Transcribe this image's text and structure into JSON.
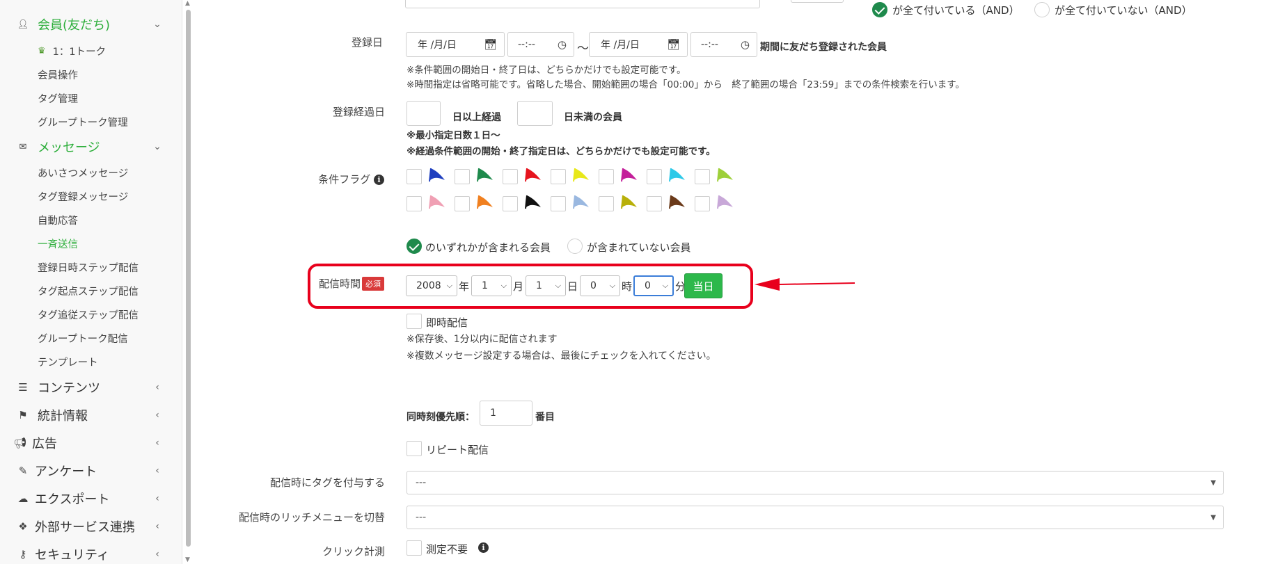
{
  "sidebar": {
    "member_section": "会員(友だち)",
    "member_items": [
      "1：1トーク",
      "会員操作",
      "タグ管理",
      "グループトーク管理"
    ],
    "message_section": "メッセージ",
    "message_items": [
      "あいさつメッセージ",
      "タグ登録メッセージ",
      "自動応答",
      "一斉送信",
      "登録日時ステップ配信",
      "タグ起点ステップ配信",
      "タグ追従ステップ配信",
      "グループトーク配信",
      "テンプレート"
    ],
    "sections": [
      "コンテンツ",
      "統計情報",
      "広告",
      "アンケート",
      "エクスポート",
      "外部サービス連携",
      "セキュリティ"
    ],
    "active_color": "#2cae3a"
  },
  "top": {
    "tag_and_all": "が全て付いている（AND）",
    "tag_and_none": "が全て付いていない（AND）"
  },
  "registration_date": {
    "label": "登録日",
    "date_placeholder": "年 /月/日",
    "time_placeholder": "--:--",
    "tilde": "～",
    "suffix": "期間に友だち登録された会員",
    "note1": "※条件範囲の開始日・終了日は、どちらかだけでも設定可能です。",
    "note2": "※時間指定は省略可能です。省略した場合、開始範囲の場合「00:00」から　終了範囲の場合「23:59」までの条件検索を行います。"
  },
  "elapsed_days": {
    "label": "登録経過日",
    "suffix1": "日以上経過",
    "suffix2": "日未満の会員",
    "note1": "※最小指定日数１日～",
    "note2": "※経過条件範囲の開始・終了指定日は、どちらかだけでも設定可能です。"
  },
  "condition_flag": {
    "label": "条件フラグ",
    "colors_row1": [
      "#1f3fbf",
      "#1f8a4c",
      "#e6141e",
      "#e8e81a",
      "#c41f9a",
      "#2ec9e8",
      "#9ed03a"
    ],
    "colors_row2": [
      "#f0a0b4",
      "#f08020",
      "#111111",
      "#9ab8e0",
      "#b8b00a",
      "#6b3a1a",
      "#c8a8d8"
    ],
    "include_label": "のいずれかが含まれる会員",
    "exclude_label": "が含まれていない会員"
  },
  "delivery_time": {
    "label": "配信時間",
    "required": "必須",
    "year": "2008",
    "year_unit": "年",
    "month": "1",
    "month_unit": "月",
    "day": "1",
    "day_unit": "日",
    "hour": "0",
    "hour_unit": "時",
    "minute": "0",
    "minute_unit": "分",
    "today_button": "当日",
    "highlight_color": "#e8001c"
  },
  "immediate": {
    "label": "即時配信",
    "note1": "※保存後、1分以内に配信されます",
    "note2": "※複数メッセージ設定する場合は、最後にチェックを入れてください。"
  },
  "priority": {
    "label": "同時刻優先順：",
    "value": "1",
    "suffix": "番目"
  },
  "repeat": {
    "label": "リピート配信"
  },
  "tag_on_delivery": {
    "label": "配信時にタグを付与する",
    "value": "---"
  },
  "rich_menu": {
    "label": "配信時のリッチメニューを切替",
    "value": "---"
  },
  "click_measure": {
    "label": "クリック計測",
    "option": "測定不要"
  }
}
